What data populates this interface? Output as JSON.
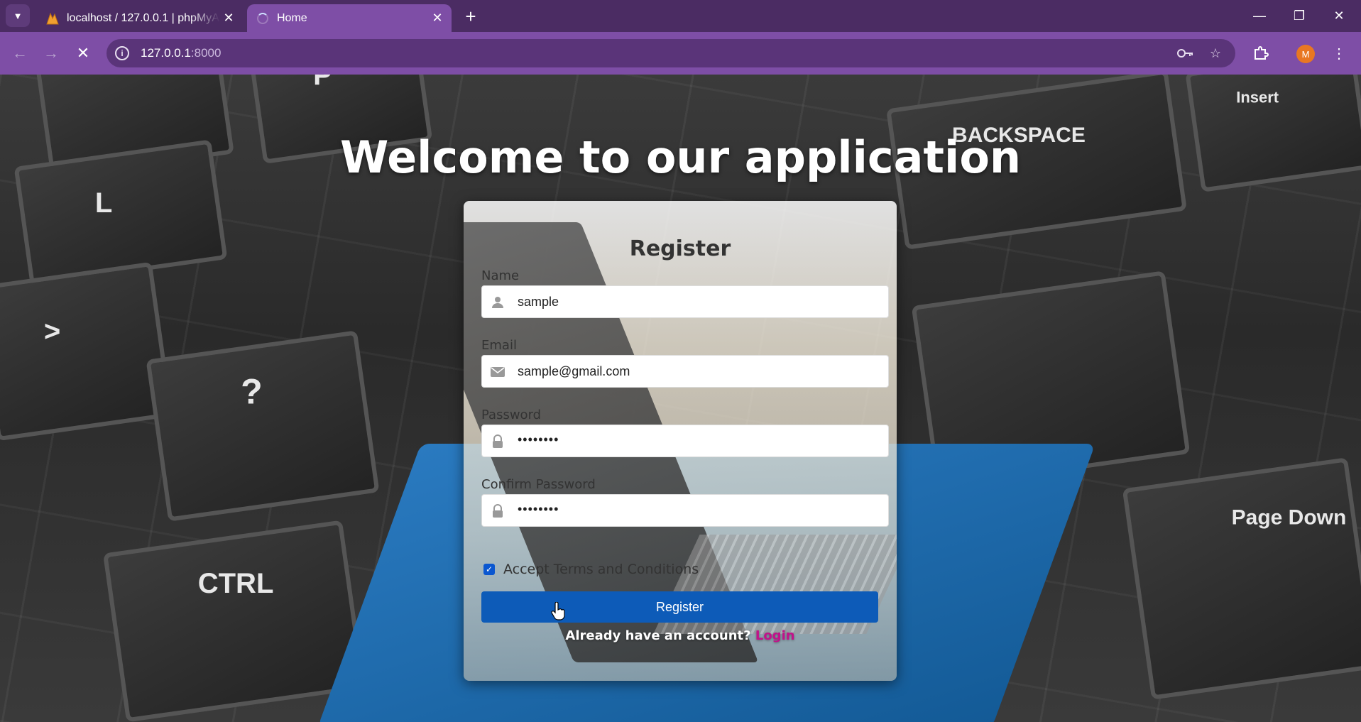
{
  "browser": {
    "tabs": [
      {
        "title": "localhost / 127.0.0.1 | phpMyAdmin",
        "favicon": "phpmyadmin-icon",
        "active": false
      },
      {
        "title": "Home",
        "favicon": "loading-spinner-icon",
        "active": true
      }
    ],
    "new_tab_label": "+",
    "url_host": "127.0.0.1",
    "url_port": ":8000",
    "profile_initial": "M",
    "accent_color": "#7e4ea6",
    "tabbar_color": "#4b2c63"
  },
  "page": {
    "heading": "Welcome to our application",
    "form": {
      "title": "Register",
      "name_label": "Name",
      "name_value": "sample",
      "email_label": "Email",
      "email_value": "sample@gmail.com",
      "password_label": "Password",
      "password_value": "••••••••",
      "confirm_label": "Confirm Password",
      "confirm_value": "••••••••",
      "terms_label": "Accept Terms and Conditions",
      "terms_checked": true,
      "submit_label": "Register",
      "submit_color": "#0d5bb8",
      "login_prompt": "Already have an account?",
      "login_link": "Login",
      "login_link_color": "#c2128a"
    },
    "background_keys": [
      "P",
      "L",
      "BACKSPACE",
      "Insert",
      "CTRL",
      "Page Down",
      "?",
      ">"
    ]
  }
}
